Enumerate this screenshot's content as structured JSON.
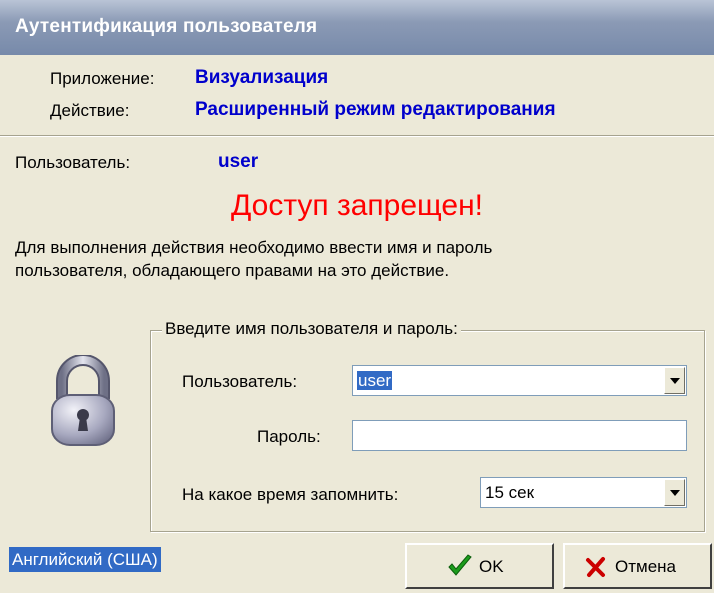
{
  "window": {
    "title": "Аутентификация пользователя"
  },
  "info": {
    "app_label": "Приложение:",
    "app_value": "Визуализация",
    "action_label": "Действие:",
    "action_value": "Расширенный режим редактирования",
    "user_label": "Пользователь:",
    "user_value": "user"
  },
  "message": {
    "denied": "Доступ запрещен!",
    "line1": "Для выполнения действия необходимо ввести имя и пароль",
    "line2": "пользователя, обладающего правами на это действие."
  },
  "form": {
    "group_caption": "Введите имя пользователя и пароль:",
    "user_label": "Пользователь:",
    "user_value": "user",
    "password_label": "Пароль:",
    "password_value": "",
    "remember_label": "На какое время запомнить:",
    "remember_value": "15 сек"
  },
  "footer": {
    "language": "Английский (США)",
    "ok_label": "OK",
    "cancel_label": "Отмена"
  },
  "colors": {
    "accent": "#0000cc",
    "error": "#ff0000",
    "selection": "#316ac5"
  },
  "icons": [
    "padlock-icon",
    "checkmark-icon",
    "cross-icon",
    "dropdown-arrow-icon"
  ]
}
